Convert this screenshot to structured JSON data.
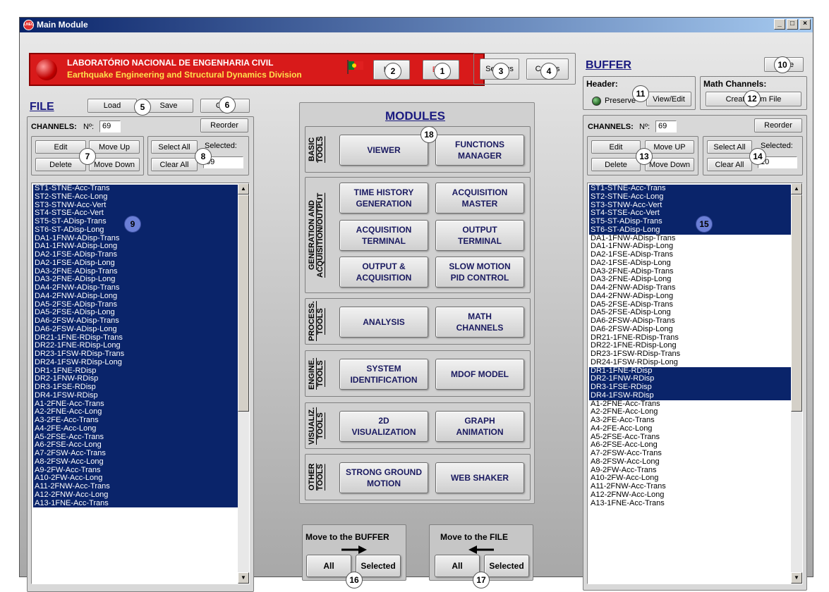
{
  "window": {
    "title": "Main Module",
    "minimize": "_",
    "maximize": "□",
    "close": "×"
  },
  "header": {
    "line1": "LABORATÓRIO NACIONAL DE ENGENHARIA CIVIL",
    "line2": "Earthquake Engineering and Structural Dynamics Division",
    "help_label": "Help",
    "exit_label": "EXIT",
    "settings_label": "Settings",
    "credits_label": "Credits"
  },
  "file": {
    "title": "FILE",
    "load_label": "Load",
    "save_label": "Save",
    "clear_label": "Clear",
    "channels_label": "CHANNELS:",
    "n_label": "Nº:",
    "n_value": "69",
    "reorder_label": "Reorder",
    "edit_label": "Edit",
    "move_up_label": "Move Up",
    "delete_label": "Delete",
    "move_down_label": "Move Down",
    "select_all_label": "Select All",
    "clear_all_label": "Clear All",
    "selected_label": "Selected:",
    "selected_value": "69",
    "items": [
      "ST1-STNE-Acc-Trans",
      "ST2-STNE-Acc-Long",
      "ST3-STNW-Acc-Vert",
      "ST4-STSE-Acc-Vert",
      "ST5-ST-ADisp-Trans",
      "ST6-ST-ADisp-Long",
      "DA1-1FNW-ADisp-Trans",
      "DA1-1FNW-ADisp-Long",
      "DA2-1FSE-ADisp-Trans",
      "DA2-1FSE-ADisp-Long",
      "DA3-2FNE-ADisp-Trans",
      "DA3-2FNE-ADisp-Long",
      "DA4-2FNW-ADisp-Trans",
      "DA4-2FNW-ADisp-Long",
      "DA5-2FSE-ADisp-Trans",
      "DA5-2FSE-ADisp-Long",
      "DA6-2FSW-ADisp-Trans",
      "DA6-2FSW-ADisp-Long",
      "DR21-1FNE-RDisp-Trans",
      "DR22-1FNE-RDisp-Long",
      "DR23-1FSW-RDisp-Trans",
      "DR24-1FSW-RDisp-Long",
      "DR1-1FNE-RDisp",
      "DR2-1FNW-RDisp",
      "DR3-1FSE-RDisp",
      "DR4-1FSW-RDisp",
      "A1-2FNE-Acc-Trans",
      "A2-2FNE-Acc-Long",
      "A3-2FE-Acc-Trans",
      "A4-2FE-Acc-Long",
      "A5-2FSE-Acc-Trans",
      "A6-2FSE-Acc-Long",
      "A7-2FSW-Acc-Trans",
      "A8-2FSW-Acc-Long",
      "A9-2FW-Acc-Trans",
      "A10-2FW-Acc-Long",
      "A11-2FNW-Acc-Trans",
      "A12-2FNW-Acc-Long",
      "A13-1FNE-Acc-Trans"
    ]
  },
  "modules": {
    "title": "MODULES",
    "groups": [
      {
        "label": "BASIC\nTOOLS",
        "buttons": [
          "VIEWER",
          "FUNCTIONS\nMANAGER"
        ]
      },
      {
        "label": "GENERATION AND\nACQUISITION/OUTPUT",
        "buttons": [
          "TIME HISTORY\nGENERATION",
          "ACQUISITION\nMASTER",
          "ACQUISITION\nTERMINAL",
          "OUTPUT\nTERMINAL",
          "OUTPUT &\nACQUISITION",
          "SLOW MOTION\nPID CONTROL"
        ]
      },
      {
        "label": "PROCESS.\nTOOLS",
        "buttons": [
          "ANALYSIS",
          "MATH\nCHANNELS"
        ]
      },
      {
        "label": "ENGINE.\nTOOLS",
        "buttons": [
          "SYSTEM\nIDENTIFICATION",
          "MDOF MODEL"
        ]
      },
      {
        "label": "VISUALIZ.\nTOOLS",
        "buttons": [
          "2D\nVISUALIZATION",
          "GRAPH\nANIMATION"
        ]
      },
      {
        "label": "OTHER\nTOOLS",
        "buttons": [
          "STRONG GROUND\nMOTION",
          "WEB SHAKER"
        ]
      }
    ]
  },
  "move_buffer": {
    "title": "Move to the BUFFER",
    "all_label": "All",
    "selected_label": "Selected"
  },
  "move_file": {
    "title": "Move to the FILE",
    "all_label": "All",
    "selected_label": "Selected"
  },
  "buffer": {
    "title": "BUFFER",
    "close_label": "Close",
    "header_label": "Header:",
    "preserve_label": "Preserve",
    "view_edit_label": "View/Edit",
    "math_label": "Math Channels:",
    "create_label": "Create from File",
    "channels_label": "CHANNELS:",
    "n_label": "Nº:",
    "n_value": "69",
    "reorder_label": "Reorder",
    "edit_label": "Edit",
    "move_up_label": "Move UP",
    "delete_label": "Delete",
    "move_down_label": "Move Down",
    "select_all_label": "Select All",
    "clear_all_label": "Clear All",
    "selected_label": "Selected:",
    "selected_value": "10",
    "items": [
      "ST1-STNE-Acc-Trans",
      "ST2-STNE-Acc-Long",
      "ST3-STNW-Acc-Vert",
      "ST4-STSE-Acc-Vert",
      "ST5-ST-ADisp-Trans",
      "ST6-ST-ADisp-Long",
      "DA1-1FNW-ADisp-Trans",
      "DA1-1FNW-ADisp-Long",
      "DA2-1FSE-ADisp-Trans",
      "DA2-1FSE-ADisp-Long",
      "DA3-2FNE-ADisp-Trans",
      "DA3-2FNE-ADisp-Long",
      "DA4-2FNW-ADisp-Trans",
      "DA4-2FNW-ADisp-Long",
      "DA5-2FSE-ADisp-Trans",
      "DA5-2FSE-ADisp-Long",
      "DA6-2FSW-ADisp-Trans",
      "DA6-2FSW-ADisp-Long",
      "DR21-1FNE-RDisp-Trans",
      "DR22-1FNE-RDisp-Long",
      "DR23-1FSW-RDisp-Trans",
      "DR24-1FSW-RDisp-Long",
      "DR1-1FNE-RDisp",
      "DR2-1FNW-RDisp",
      "DR3-1FSE-RDisp",
      "DR4-1FSW-RDisp",
      "A1-2FNE-Acc-Trans",
      "A2-2FNE-Acc-Long",
      "A3-2FE-Acc-Trans",
      "A4-2FE-Acc-Long",
      "A5-2FSE-Acc-Trans",
      "A6-2FSE-Acc-Long",
      "A7-2FSW-Acc-Trans",
      "A8-2FSW-Acc-Long",
      "A9-2FW-Acc-Trans",
      "A10-2FW-Acc-Long",
      "A11-2FNW-Acc-Trans",
      "A12-2FNW-Acc-Long",
      "A13-1FNE-Acc-Trans"
    ],
    "selected_indices": [
      0,
      1,
      2,
      3,
      4,
      5,
      22,
      23,
      24,
      25
    ]
  },
  "badges": [
    "1",
    "2",
    "3",
    "4",
    "5",
    "6",
    "7",
    "8",
    "9",
    "10",
    "11",
    "12",
    "13",
    "14",
    "15",
    "16",
    "17",
    "18"
  ],
  "colors": {
    "selection": "#0a246a",
    "banner_red": "#d81a1a",
    "banner_yellow": "#ffe04d",
    "module_text": "#1a1a60"
  }
}
